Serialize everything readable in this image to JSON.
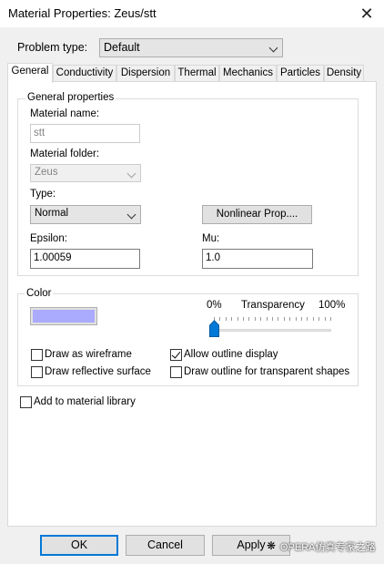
{
  "window": {
    "title": "Material Properties: Zeus/stt"
  },
  "problem_type": {
    "label": "Problem type:",
    "value": "Default"
  },
  "tabs": [
    {
      "label": "General",
      "active": true
    },
    {
      "label": "Conductivity"
    },
    {
      "label": "Dispersion"
    },
    {
      "label": "Thermal"
    },
    {
      "label": "Mechanics"
    },
    {
      "label": "Particles"
    },
    {
      "label": "Density"
    }
  ],
  "general": {
    "group_title": "General properties",
    "material_name_label": "Material name:",
    "material_name_value": "stt",
    "material_folder_label": "Material folder:",
    "material_folder_value": "Zeus",
    "type_label": "Type:",
    "type_value": "Normal",
    "nonlinear_button": "Nonlinear Prop....",
    "epsilon_label": "Epsilon:",
    "epsilon_value": "1.00059",
    "mu_label": "Mu:",
    "mu_value": "1.0"
  },
  "color": {
    "group_title": "Color",
    "swatch_color": "#aaaaff",
    "transparency_min": "0%",
    "transparency_label": "Transparency",
    "transparency_max": "100%",
    "transparency_level": 0,
    "draw_wireframe": {
      "label": "Draw as wireframe",
      "checked": false
    },
    "allow_outline": {
      "label": "Allow outline display",
      "checked": true
    },
    "draw_reflective": {
      "label": "Draw reflective surface",
      "checked": false
    },
    "draw_outline_transparent": {
      "label": "Draw outline for transparent shapes",
      "checked": false
    }
  },
  "add_to_library": {
    "label": "Add to material library",
    "checked": false
  },
  "buttons": {
    "ok": "OK",
    "cancel": "Cancel",
    "apply": "Apply"
  },
  "watermark": "OPERA仿真专家之路"
}
